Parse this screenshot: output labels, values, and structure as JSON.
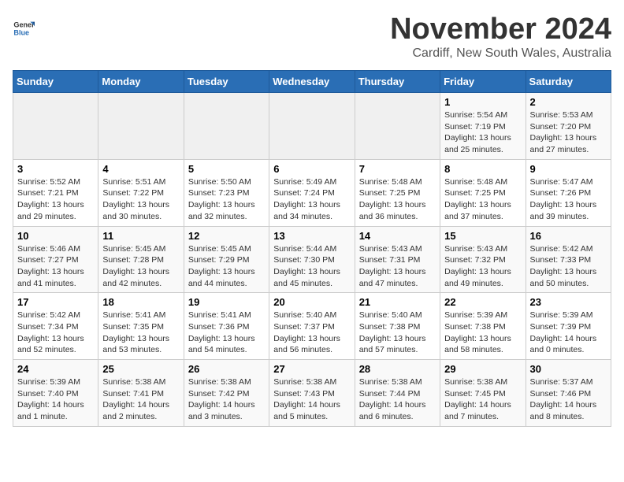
{
  "header": {
    "logo_general": "General",
    "logo_blue": "Blue",
    "title": "November 2024",
    "subtitle": "Cardiff, New South Wales, Australia"
  },
  "calendar": {
    "days_of_week": [
      "Sunday",
      "Monday",
      "Tuesday",
      "Wednesday",
      "Thursday",
      "Friday",
      "Saturday"
    ],
    "weeks": [
      [
        {
          "day": "",
          "content": ""
        },
        {
          "day": "",
          "content": ""
        },
        {
          "day": "",
          "content": ""
        },
        {
          "day": "",
          "content": ""
        },
        {
          "day": "",
          "content": ""
        },
        {
          "day": "1",
          "content": "Sunrise: 5:54 AM\nSunset: 7:19 PM\nDaylight: 13 hours\nand 25 minutes."
        },
        {
          "day": "2",
          "content": "Sunrise: 5:53 AM\nSunset: 7:20 PM\nDaylight: 13 hours\nand 27 minutes."
        }
      ],
      [
        {
          "day": "3",
          "content": "Sunrise: 5:52 AM\nSunset: 7:21 PM\nDaylight: 13 hours\nand 29 minutes."
        },
        {
          "day": "4",
          "content": "Sunrise: 5:51 AM\nSunset: 7:22 PM\nDaylight: 13 hours\nand 30 minutes."
        },
        {
          "day": "5",
          "content": "Sunrise: 5:50 AM\nSunset: 7:23 PM\nDaylight: 13 hours\nand 32 minutes."
        },
        {
          "day": "6",
          "content": "Sunrise: 5:49 AM\nSunset: 7:24 PM\nDaylight: 13 hours\nand 34 minutes."
        },
        {
          "day": "7",
          "content": "Sunrise: 5:48 AM\nSunset: 7:25 PM\nDaylight: 13 hours\nand 36 minutes."
        },
        {
          "day": "8",
          "content": "Sunrise: 5:48 AM\nSunset: 7:25 PM\nDaylight: 13 hours\nand 37 minutes."
        },
        {
          "day": "9",
          "content": "Sunrise: 5:47 AM\nSunset: 7:26 PM\nDaylight: 13 hours\nand 39 minutes."
        }
      ],
      [
        {
          "day": "10",
          "content": "Sunrise: 5:46 AM\nSunset: 7:27 PM\nDaylight: 13 hours\nand 41 minutes."
        },
        {
          "day": "11",
          "content": "Sunrise: 5:45 AM\nSunset: 7:28 PM\nDaylight: 13 hours\nand 42 minutes."
        },
        {
          "day": "12",
          "content": "Sunrise: 5:45 AM\nSunset: 7:29 PM\nDaylight: 13 hours\nand 44 minutes."
        },
        {
          "day": "13",
          "content": "Sunrise: 5:44 AM\nSunset: 7:30 PM\nDaylight: 13 hours\nand 45 minutes."
        },
        {
          "day": "14",
          "content": "Sunrise: 5:43 AM\nSunset: 7:31 PM\nDaylight: 13 hours\nand 47 minutes."
        },
        {
          "day": "15",
          "content": "Sunrise: 5:43 AM\nSunset: 7:32 PM\nDaylight: 13 hours\nand 49 minutes."
        },
        {
          "day": "16",
          "content": "Sunrise: 5:42 AM\nSunset: 7:33 PM\nDaylight: 13 hours\nand 50 minutes."
        }
      ],
      [
        {
          "day": "17",
          "content": "Sunrise: 5:42 AM\nSunset: 7:34 PM\nDaylight: 13 hours\nand 52 minutes."
        },
        {
          "day": "18",
          "content": "Sunrise: 5:41 AM\nSunset: 7:35 PM\nDaylight: 13 hours\nand 53 minutes."
        },
        {
          "day": "19",
          "content": "Sunrise: 5:41 AM\nSunset: 7:36 PM\nDaylight: 13 hours\nand 54 minutes."
        },
        {
          "day": "20",
          "content": "Sunrise: 5:40 AM\nSunset: 7:37 PM\nDaylight: 13 hours\nand 56 minutes."
        },
        {
          "day": "21",
          "content": "Sunrise: 5:40 AM\nSunset: 7:38 PM\nDaylight: 13 hours\nand 57 minutes."
        },
        {
          "day": "22",
          "content": "Sunrise: 5:39 AM\nSunset: 7:38 PM\nDaylight: 13 hours\nand 58 minutes."
        },
        {
          "day": "23",
          "content": "Sunrise: 5:39 AM\nSunset: 7:39 PM\nDaylight: 14 hours\nand 0 minutes."
        }
      ],
      [
        {
          "day": "24",
          "content": "Sunrise: 5:39 AM\nSunset: 7:40 PM\nDaylight: 14 hours\nand 1 minute."
        },
        {
          "day": "25",
          "content": "Sunrise: 5:38 AM\nSunset: 7:41 PM\nDaylight: 14 hours\nand 2 minutes."
        },
        {
          "day": "26",
          "content": "Sunrise: 5:38 AM\nSunset: 7:42 PM\nDaylight: 14 hours\nand 3 minutes."
        },
        {
          "day": "27",
          "content": "Sunrise: 5:38 AM\nSunset: 7:43 PM\nDaylight: 14 hours\nand 5 minutes."
        },
        {
          "day": "28",
          "content": "Sunrise: 5:38 AM\nSunset: 7:44 PM\nDaylight: 14 hours\nand 6 minutes."
        },
        {
          "day": "29",
          "content": "Sunrise: 5:38 AM\nSunset: 7:45 PM\nDaylight: 14 hours\nand 7 minutes."
        },
        {
          "day": "30",
          "content": "Sunrise: 5:37 AM\nSunset: 7:46 PM\nDaylight: 14 hours\nand 8 minutes."
        }
      ]
    ]
  }
}
